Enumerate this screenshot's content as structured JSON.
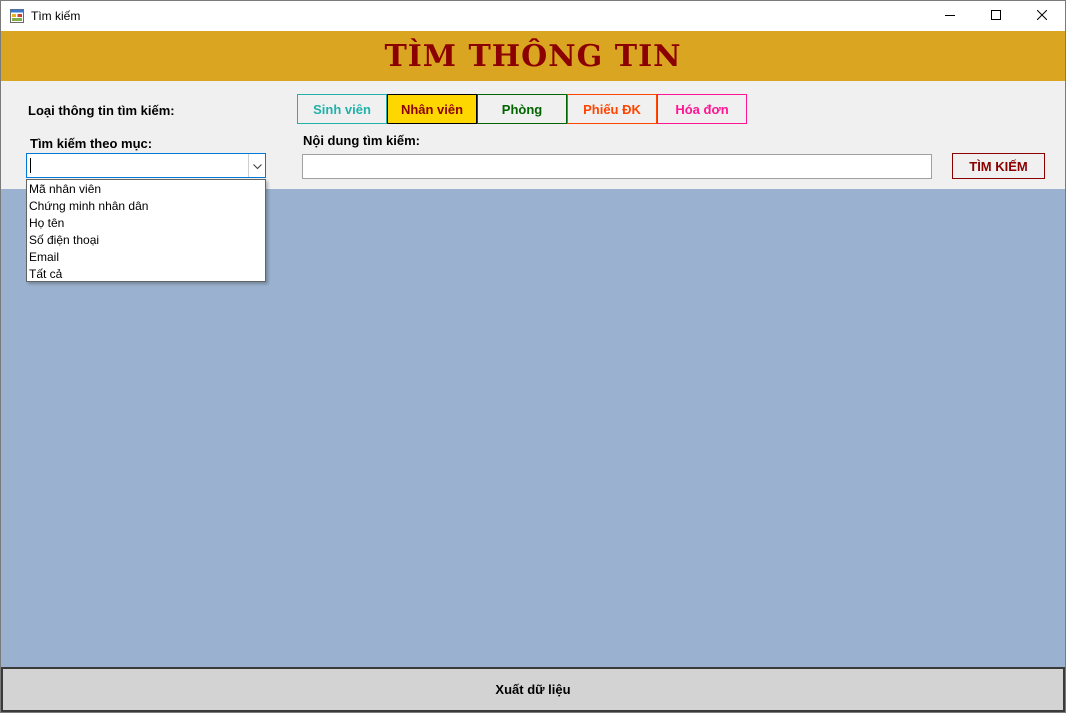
{
  "window": {
    "title": "Tìm kiếm",
    "app_icon": "form-icon",
    "controls": [
      "minimize-icon",
      "maximize-icon",
      "close-icon"
    ]
  },
  "banner": {
    "title": "TÌM THÔNG TIN"
  },
  "labels": {
    "info_type": "Loại thông tin tìm kiếm:",
    "search_by": "Tìm kiếm theo mục:",
    "content": "Nội dung tìm kiếm:"
  },
  "tabs": [
    {
      "label": "Sinh viên",
      "color": "#20b2aa",
      "selected": false
    },
    {
      "label": "Nhân viên",
      "color": "#8b0000",
      "selected": true
    },
    {
      "label": "Phòng",
      "color": "#006400",
      "selected": false
    },
    {
      "label": "Phiếu ĐK",
      "color": "#ff4500",
      "selected": false
    },
    {
      "label": "Hóa đơn",
      "color": "#ff1493",
      "selected": false
    }
  ],
  "search_by_combo": {
    "value": "",
    "expanded": true,
    "options": [
      "Mã nhân viên",
      "Chứng minh nhân dân",
      "Họ tên",
      "Số điện thoại",
      "Email",
      "Tất cả"
    ]
  },
  "search_input": {
    "value": ""
  },
  "search_button": {
    "label": "TÌM KIẾM"
  },
  "export_button": {
    "label": "Xuất dữ liệu"
  },
  "colors": {
    "banner_bg": "#daa520",
    "banner_text": "#8b0000",
    "content_bg": "#9ab2cf",
    "selected_tab_bg": "#ffd700"
  }
}
